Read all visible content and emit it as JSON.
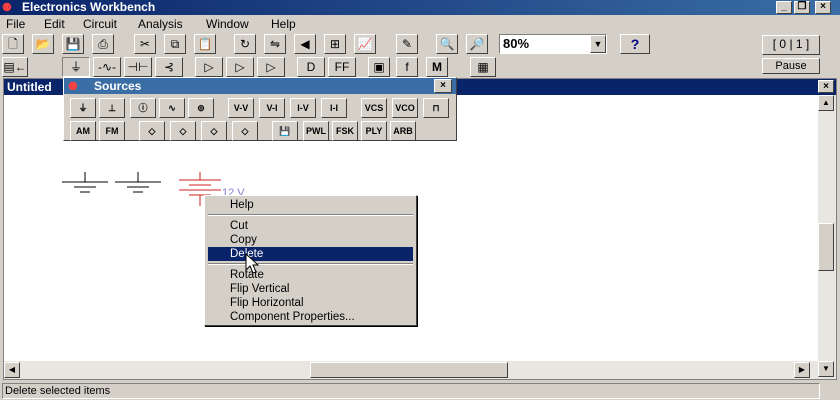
{
  "window": {
    "title": "Electronics Workbench",
    "minimize": "_",
    "restore": "❐",
    "close": "×"
  },
  "menu": [
    "File",
    "Edit",
    "Circuit",
    "Analysis",
    "Window",
    "Help"
  ],
  "toolbar": {
    "zoom_value": "80%",
    "help_label": "?",
    "pause_label": "Pause"
  },
  "document": {
    "title": "Untitled"
  },
  "sources_palette": {
    "title": "Sources",
    "row1": [
      "V-V",
      "V-I",
      "I-V",
      "I-I",
      "VCS",
      "VCO"
    ],
    "row2": [
      "PWL",
      "FSK",
      "PLY",
      "ARB"
    ]
  },
  "circuit": {
    "battery_value": "12 V"
  },
  "context_menu": {
    "items": [
      "Help",
      "Cut",
      "Copy",
      "Delete",
      "Rotate",
      "Flip Vertical",
      "Flip Horizontal",
      "Component Properties..."
    ],
    "selected": "Delete"
  },
  "status": {
    "message": "Delete selected items"
  },
  "colors": {
    "titlebar": "#0a246a",
    "selection": "#0a246a",
    "component_red": "#d02020"
  }
}
